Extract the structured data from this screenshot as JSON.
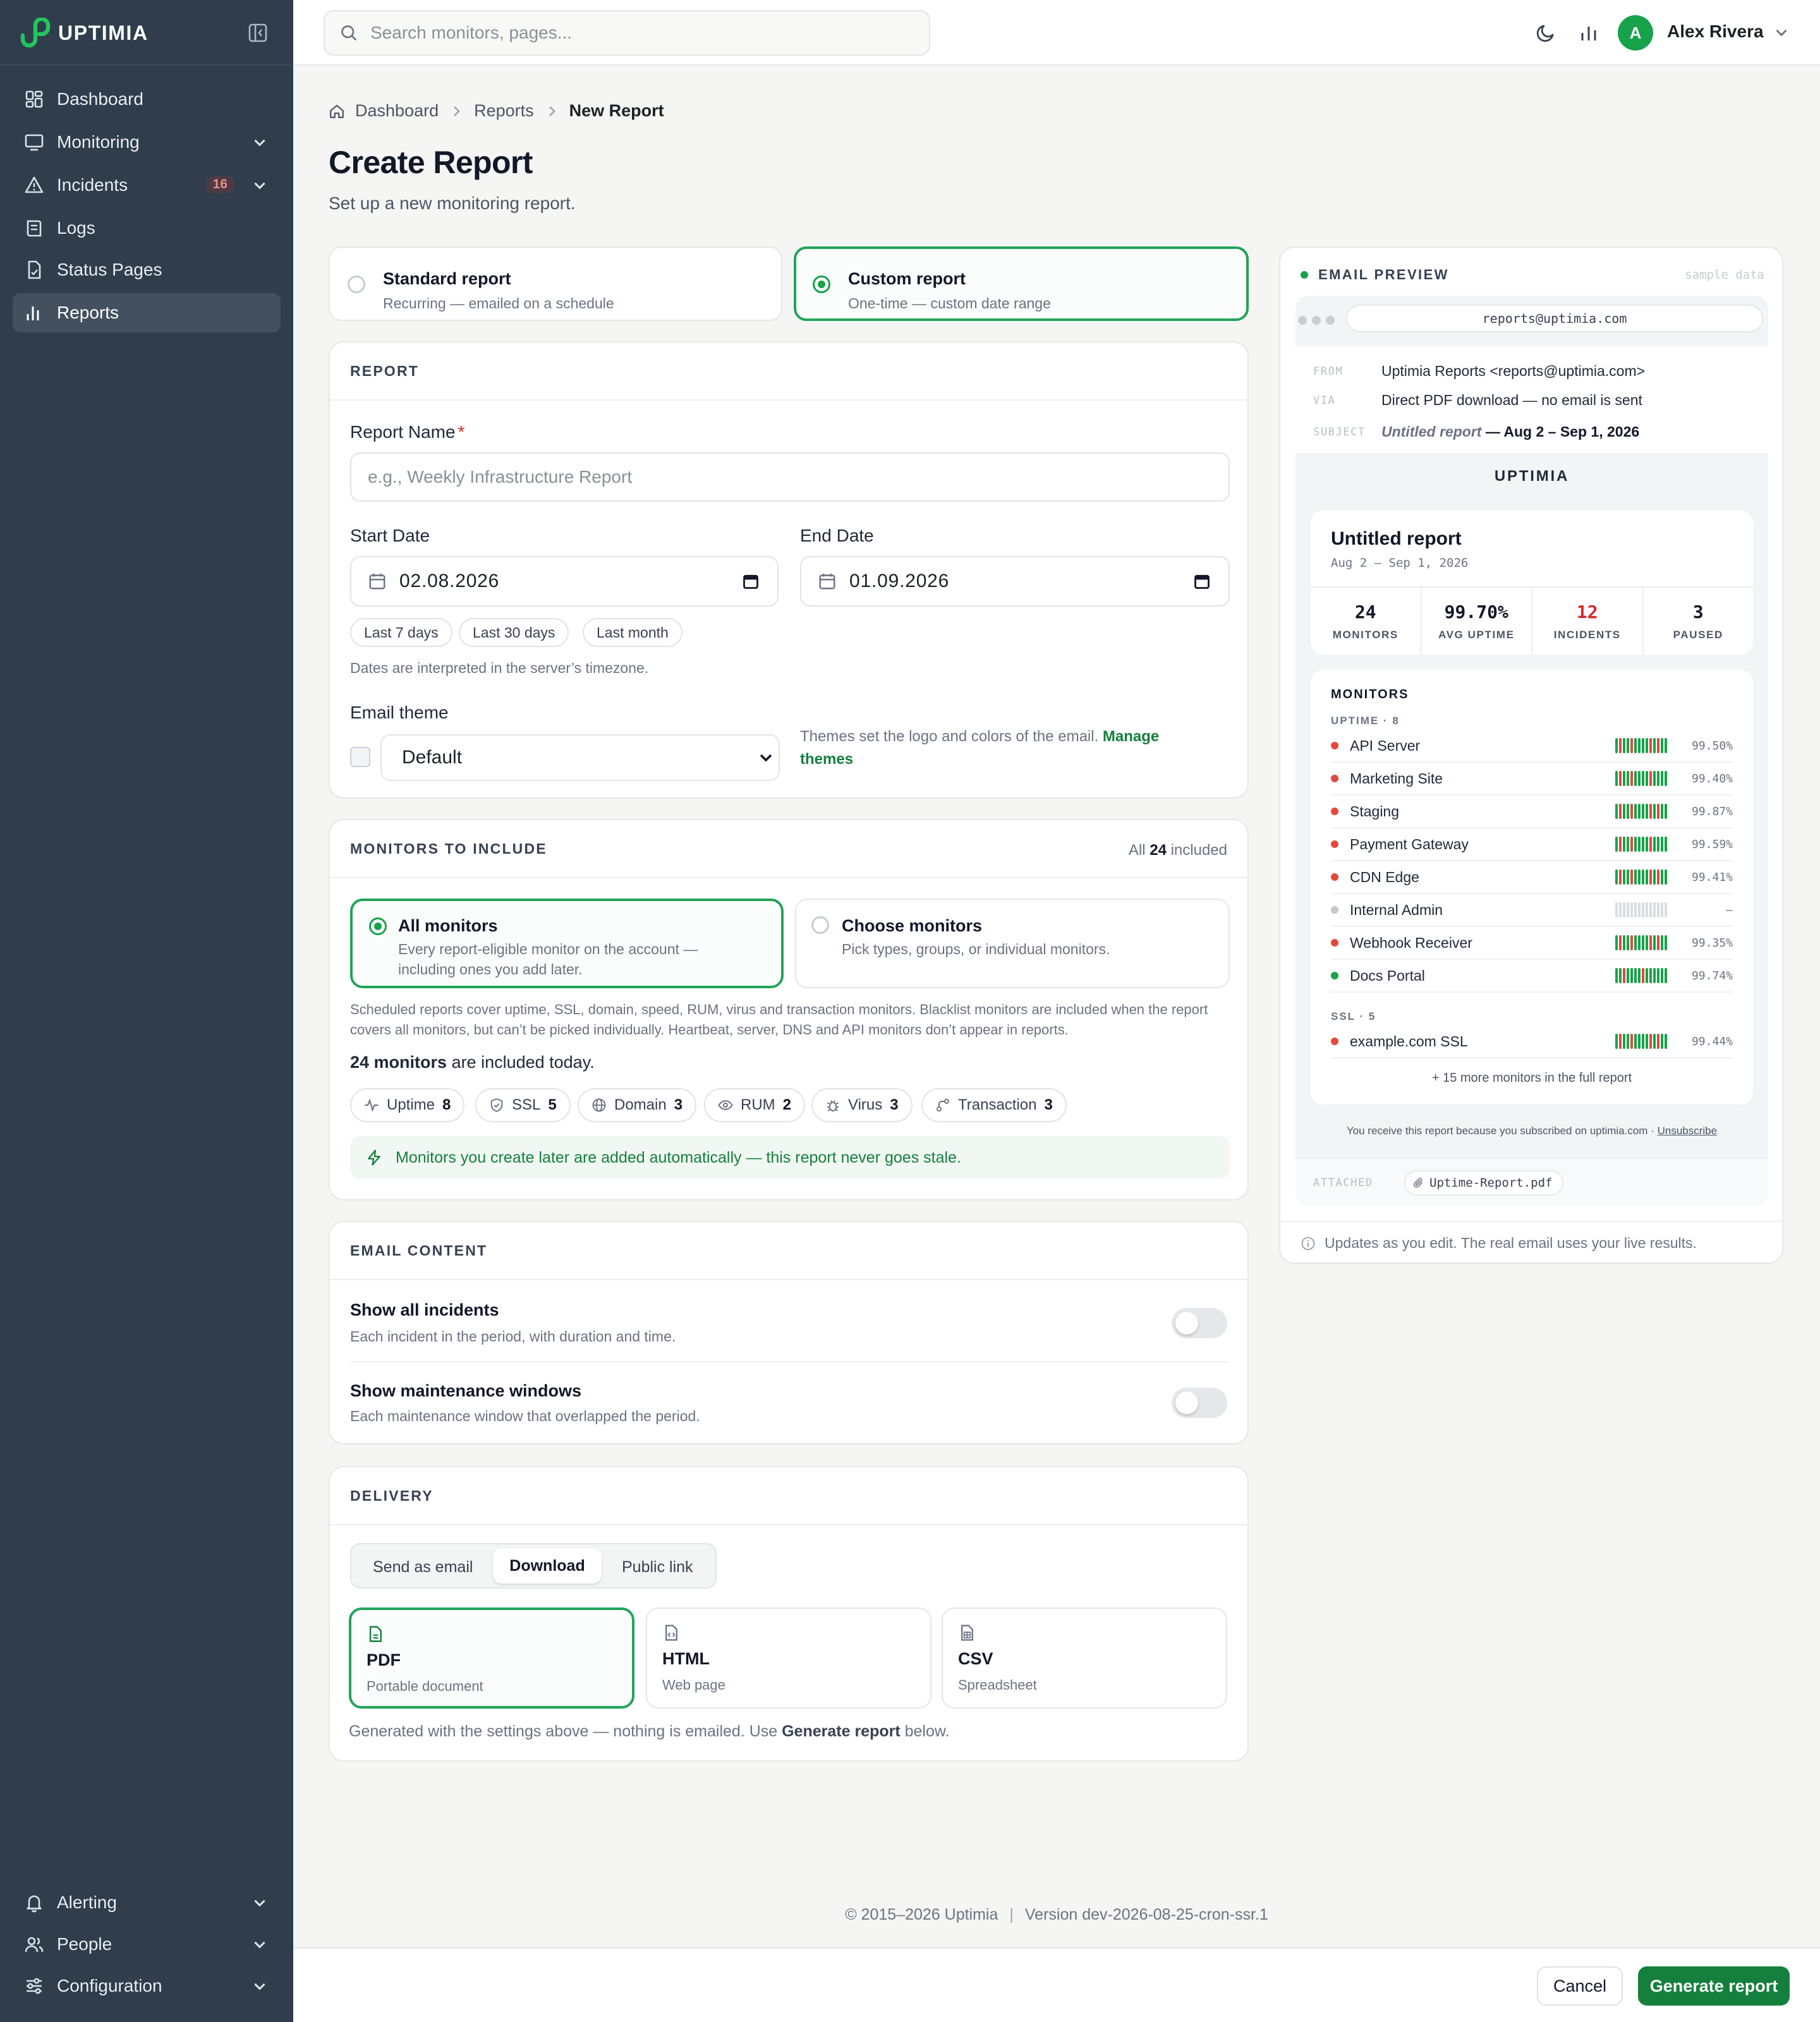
{
  "brand": {
    "name": "UPTIMIA",
    "accent": "#16a34a"
  },
  "sidebar": {
    "items": [
      {
        "label": "Dashboard"
      },
      {
        "label": "Monitoring"
      },
      {
        "label": "Incidents",
        "badge": "16"
      },
      {
        "label": "Logs"
      },
      {
        "label": "Status Pages"
      },
      {
        "label": "Reports"
      }
    ],
    "bottom": [
      {
        "label": "Alerting"
      },
      {
        "label": "People"
      },
      {
        "label": "Configuration"
      }
    ]
  },
  "topbar": {
    "search_placeholder": "Search monitors, pages...",
    "user_initial": "A",
    "user_name": "Alex Rivera"
  },
  "breadcrumb": [
    "Dashboard",
    "Reports",
    "New Report"
  ],
  "page": {
    "title": "Create Report",
    "subtitle": "Set up a new monitoring report."
  },
  "report_type": {
    "standard": {
      "title": "Standard report",
      "desc": "Recurring — emailed on a schedule"
    },
    "custom": {
      "title": "Custom report",
      "desc": "One-time — custom date range"
    },
    "selected": "custom"
  },
  "report": {
    "section": "REPORT",
    "name_label": "Report Name",
    "required": "*",
    "name_placeholder": "e.g., Weekly Infrastructure Report",
    "name_value": "",
    "start_label": "Start Date",
    "start_value": "02.08.2026",
    "end_label": "End Date",
    "end_value": "01.09.2026",
    "quick": [
      "Last 7 days",
      "Last 30 days",
      "Last month"
    ],
    "tz_hint": "Dates are interpreted in the server’s timezone.",
    "theme_label": "Email theme",
    "theme_value": "Default",
    "theme_hint": "Themes set the logo and colors of the email. ",
    "theme_link": "Manage themes"
  },
  "monitors": {
    "section": "MONITORS TO INCLUDE",
    "count_prefix": "All ",
    "count": "24",
    "count_suffix": " included",
    "all": {
      "title": "All monitors",
      "desc": "Every report-eligible monitor on the account — including ones you add later."
    },
    "choose": {
      "title": "Choose monitors",
      "desc": "Pick types, groups, or individual monitors."
    },
    "note": "Scheduled reports cover uptime, SSL, domain, speed, RUM, virus and transaction monitors. Blacklist monitors are included when the report covers all monitors, but can’t be picked individually. Heartbeat, server, DNS and API monitors don’t appear in reports.",
    "included_bold": "24 monitors",
    "included_rest": " are included today.",
    "types": [
      {
        "label": "Uptime",
        "count": "8",
        "icon": "pulse-icon"
      },
      {
        "label": "SSL",
        "count": "5",
        "icon": "shield-icon"
      },
      {
        "label": "Domain",
        "count": "3",
        "icon": "globe-icon"
      },
      {
        "label": "RUM",
        "count": "2",
        "icon": "eye-icon"
      },
      {
        "label": "Virus",
        "count": "3",
        "icon": "bug-icon"
      },
      {
        "label": "Transaction",
        "count": "3",
        "icon": "route-icon"
      }
    ],
    "auto_note": "Monitors you create later are added automatically — this report never goes stale."
  },
  "content": {
    "section": "EMAIL CONTENT",
    "incidents": {
      "title": "Show all incidents",
      "desc": "Each incident in the period, with duration and time.",
      "enabled": false
    },
    "maintenance": {
      "title": "Show maintenance windows",
      "desc": "Each maintenance window that overlapped the period.",
      "enabled": false
    }
  },
  "delivery": {
    "section": "DELIVERY",
    "tabs": [
      "Send as email",
      "Download",
      "Public link"
    ],
    "active_tab": "Download",
    "formats": [
      {
        "title": "PDF",
        "desc": "Portable document"
      },
      {
        "title": "HTML",
        "desc": "Web page"
      },
      {
        "title": "CSV",
        "desc": "Spreadsheet"
      }
    ],
    "selected_format": "PDF",
    "note_pre": "Generated with the settings above — nothing is emailed. Use ",
    "note_bold": "Generate report",
    "note_post": " below."
  },
  "preview": {
    "title": "EMAIL PREVIEW",
    "sample": "sample data",
    "address": "reports@uptimia.com",
    "from_label": "FROM",
    "from": "Uptimia Reports <reports@uptimia.com>",
    "via_label": "VIA",
    "via": "Direct PDF download — no email is sent",
    "subject_label": "SUBJECT",
    "subject_name": "Untitled report",
    "subject_range": " — Aug 2 – Sep 1, 2026",
    "brand": "UPTIMIA",
    "report_title": "Untitled report",
    "range": "Aug 2 – Sep 1, 2026",
    "stats": [
      {
        "value": "24",
        "label": "MONITORS"
      },
      {
        "value": "99.70%",
        "label": "AVG UPTIME"
      },
      {
        "value": "12",
        "label": "INCIDENTS",
        "color": "#dc2626"
      },
      {
        "value": "3",
        "label": "PAUSED"
      }
    ],
    "monitors_title": "MONITORS",
    "uptime_group": "UPTIME · 8",
    "uptime_rows": [
      {
        "name": "API Server",
        "pct": "99.50%",
        "status": "red"
      },
      {
        "name": "Marketing Site",
        "pct": "99.40%",
        "status": "red"
      },
      {
        "name": "Staging",
        "pct": "99.87%",
        "status": "red"
      },
      {
        "name": "Payment Gateway",
        "pct": "99.59%",
        "status": "red"
      },
      {
        "name": "CDN Edge",
        "pct": "99.41%",
        "status": "red"
      },
      {
        "name": "Internal Admin",
        "pct": "–",
        "status": "gray"
      },
      {
        "name": "Webhook Receiver",
        "pct": "99.35%",
        "status": "red"
      },
      {
        "name": "Docs Portal",
        "pct": "99.74%",
        "status": "green"
      }
    ],
    "ssl_group": "SSL · 5",
    "ssl_rows": [
      {
        "name": "example.com SSL",
        "pct": "99.44%",
        "status": "red"
      }
    ],
    "more": "+ 15 more monitors in the full report",
    "footer_pre": "You receive this report because you subscribed on uptimia.com · ",
    "footer_link": "Unsubscribe",
    "attached_label": "ATTACHED",
    "attachment": "Uptime-Report.pdf",
    "updates": "Updates as you edit. The real email uses your live results."
  },
  "footer": {
    "copyright": "© 2015–2026 Uptimia",
    "version": "Version dev-2026-08-25-cron-ssr.1"
  },
  "actions": {
    "cancel": "Cancel",
    "generate": "Generate report"
  }
}
